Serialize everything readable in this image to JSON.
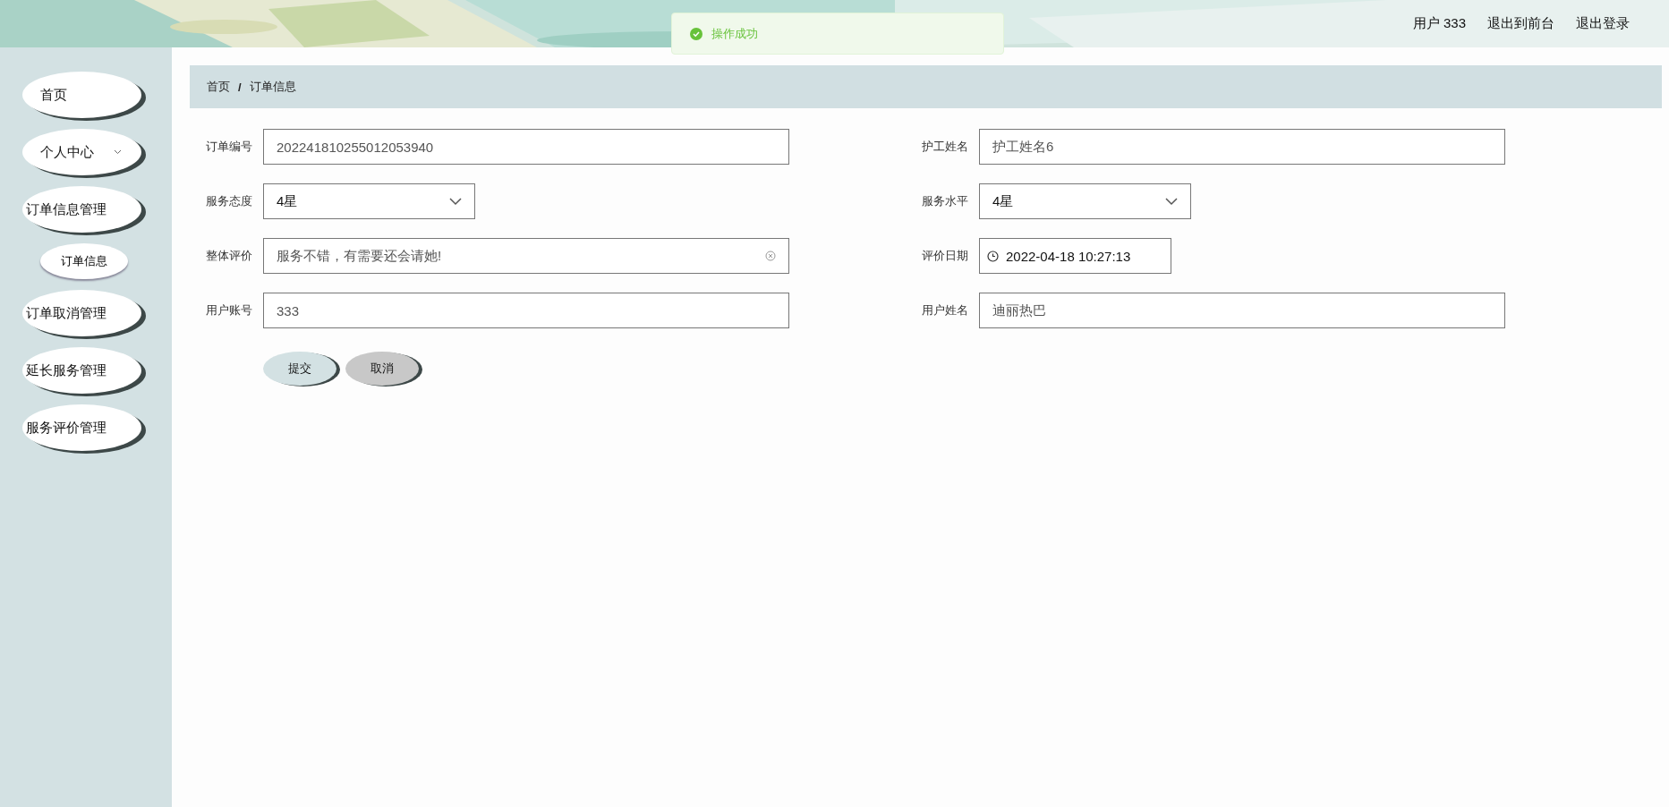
{
  "header": {
    "user_links": [
      "用户 333",
      "退出到前台",
      "退出登录"
    ]
  },
  "toast": {
    "kind": "success",
    "message": "操作成功"
  },
  "sidebar": {
    "items": [
      {
        "label": "首页",
        "expandable": false
      },
      {
        "label": "个人中心",
        "expandable": true
      },
      {
        "label": "订单信息管理",
        "expandable": false,
        "children": [
          {
            "label": "订单信息"
          }
        ]
      },
      {
        "label": "订单取消管理",
        "expandable": false
      },
      {
        "label": "延长服务管理",
        "expandable": false
      },
      {
        "label": "服务评价管理",
        "expandable": false
      }
    ]
  },
  "breadcrumb": {
    "items": [
      "首页",
      "订单信息"
    ],
    "separator": "/"
  },
  "form": {
    "left": [
      {
        "label": "订单编号",
        "kind": "text",
        "value": "202241810255012053940"
      },
      {
        "label": "服务态度",
        "kind": "select",
        "value": "4星"
      },
      {
        "label": "整体评价",
        "kind": "clearable",
        "value": "服务不错，有需要还会请她!"
      },
      {
        "label": "用户账号",
        "kind": "text",
        "value": "333"
      }
    ],
    "right": [
      {
        "label": "护工姓名",
        "kind": "text",
        "value": "护工姓名6"
      },
      {
        "label": "服务水平",
        "kind": "select",
        "value": "4星"
      },
      {
        "label": "评价日期",
        "kind": "date",
        "value": "2022-04-18 10:27:13"
      },
      {
        "label": "用户姓名",
        "kind": "text",
        "value": "迪丽热巴"
      }
    ],
    "buttons": [
      {
        "label": "提交",
        "kind": "primary"
      },
      {
        "label": "取消",
        "kind": "secondary"
      }
    ]
  }
}
